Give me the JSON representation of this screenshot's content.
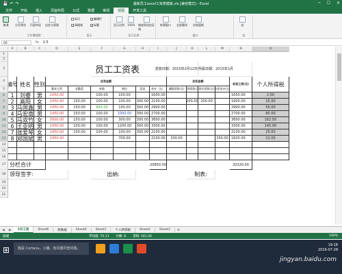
{
  "window": {
    "title": "最新员工excel工资表模板.xls [兼容模式] - Excel",
    "controls": [
      "─",
      "☐",
      "✕"
    ],
    "qat_icons": [
      "save-icon",
      "undo-icon",
      "redo-icon"
    ]
  },
  "ribbon": {
    "tabs": [
      "文件",
      "开始",
      "插入",
      "页面布局",
      "公式",
      "数据",
      "审阅",
      "视图",
      "开发工具"
    ],
    "active_tab": "视图",
    "groups": [
      {
        "label": "工作簿视图",
        "buttons": [
          "普通",
          "分页预览",
          "页面布局",
          "自定义视图"
        ]
      },
      {
        "label": "显示",
        "checks": [
          {
            "label": "标尺",
            "checked": false
          },
          {
            "label": "编辑栏",
            "checked": true
          },
          {
            "label": "网格线",
            "checked": true
          },
          {
            "label": "标题",
            "checked": true
          }
        ]
      },
      {
        "label": "显示比例",
        "buttons": [
          "显示比例",
          "100%",
          "缩放到选定区域"
        ]
      },
      {
        "label": "窗口",
        "buttons": [
          "新建窗口",
          "全部重排",
          "冻结窗格"
        ]
      },
      {
        "label": "宏",
        "buttons": [
          "宏"
        ]
      }
    ]
  },
  "formula_bar": {
    "name_box": "O6",
    "fx": "fx",
    "value": "2.5"
  },
  "grid": {
    "columns": [
      "A",
      "B",
      "C",
      "D",
      "E",
      "F",
      "G",
      "H",
      "I",
      "J",
      "K",
      "L",
      "M",
      "N",
      "O"
    ],
    "selected_column": "O",
    "rows": [
      "1",
      "2",
      "3",
      "4",
      "5",
      "6",
      "7",
      "8",
      "9",
      "10",
      "11",
      "12",
      "13",
      "14",
      "15",
      "16",
      "17",
      "18",
      "19",
      "20",
      "21"
    ],
    "selected_rows": [
      "6",
      "7",
      "8",
      "9",
      "10",
      "11",
      "12",
      "13"
    ]
  },
  "payroll": {
    "title": "员工工资表",
    "issue_date": "发放日期：2015年2月12日",
    "period": "所属日期：2015年1月",
    "header": {
      "number": "编号",
      "name": "姓名",
      "gender": "性别",
      "should_pay": "应发金额",
      "should_deduct": "应扣金额",
      "base": "基本工资",
      "full_attendance": "全勤奖",
      "subsidy": "补助",
      "post": "岗位",
      "bonus": "奖金",
      "total": "合计（元）",
      "leave_deduct": "请假扣款(元)",
      "late_deduct": "迟到扣款(元)",
      "other_deduct": "其它扣款(元)",
      "deduct_total": "应扣合计(元)",
      "actual": "实发工资(元)",
      "tax": "个人所得税"
    },
    "employees": [
      {
        "no": "1",
        "name": "刘睿",
        "gender": "男",
        "base": "1450.00",
        "full": "",
        "subsidy": "100.00",
        "post": "100.00",
        "bonus": "",
        "total": "1650.00",
        "leave": "",
        "late": "",
        "other": "",
        "deduct": "",
        "actual": "1650.00",
        "tax": "2.50"
      },
      {
        "no": "2",
        "name": "高阳",
        "gender": "女",
        "base": "1450.00",
        "full": "150.00",
        "subsidy": "100.00",
        "post": "100.00",
        "bonus": "300.00",
        "total": "2100.00",
        "leave": "",
        "late": "200.00",
        "other": "200.00",
        "deduct": "",
        "actual": "1900.00",
        "tax": "15.00"
      },
      {
        "no": "3",
        "name": "马国鑫",
        "gender": "男",
        "base": "1450.00",
        "full": "150.00",
        "subsidy": "900.00",
        "post": "100.00",
        "bonus": "300.00",
        "total": "2900.00",
        "leave": "",
        "late": "",
        "other": "",
        "deduct": "",
        "actual": "2900.00",
        "tax": "55.00"
      },
      {
        "no": "4",
        "name": "马宏南",
        "gender": "男",
        "base": "1450.00",
        "full": "150.00",
        "subsidy": "100.00",
        "post": "1000.00",
        "bonus": "300.00",
        "total": "2700.00",
        "leave": "",
        "late": "",
        "other": "",
        "deduct": "",
        "actual": "2700.00",
        "tax": "85.00"
      },
      {
        "no": "5",
        "name": "马双竹",
        "gender": "女",
        "base": "3000.00",
        "full": "150.00",
        "subsidy": "100.00",
        "post": "300.00",
        "bonus": "300.00",
        "total": "3850.00",
        "leave": "",
        "late": "",
        "other": "",
        "deduct": "",
        "actual": "3850.00",
        "tax": "162.50"
      },
      {
        "no": "6",
        "name": "王亚明",
        "gender": "男",
        "base": "1450.00",
        "full": "150.00",
        "subsidy": "100.00",
        "post": "1200.00",
        "bonus": "300.00",
        "total": "3300.00",
        "leave": "",
        "late": "",
        "other": "",
        "deduct": "",
        "actual": "3300.00",
        "tax": "145.00"
      },
      {
        "no": "7",
        "name": "张爱琴",
        "gender": "女",
        "base": "1450.00",
        "full": "150.00",
        "subsidy": "100.00",
        "post": "100.00",
        "bonus": "300.00",
        "total": "2100.00",
        "leave": "",
        "late": "",
        "other": "",
        "deduct": "",
        "actual": "2100.00",
        "tax": "25.00"
      },
      {
        "no": "8",
        "name": "郑国斌",
        "gender": "男",
        "base": "1450.00",
        "full": "",
        "subsidy": "",
        "post": "700.00",
        "bonus": "",
        "total": "2150.00",
        "leave": "330.00",
        "late": "",
        "other": "",
        "deduct": "330.00",
        "actual": "1820.00",
        "tax": "11.00"
      }
    ],
    "subtotal_label": "分栏合计",
    "subtotal_total": "20850.00",
    "subtotal_actual": "20320.00",
    "sign": {
      "leader": "领导签字:",
      "cashier": "出纳:",
      "preparer": "制表:"
    }
  },
  "sheet_tabs": {
    "tabs": [
      "5月工资",
      "Sheet6",
      "原数据",
      "Sheet4",
      "Sheet1",
      "个人所得税",
      "Sheet2",
      "Sheet3"
    ],
    "active": "5月工资"
  },
  "status_bar": {
    "ready": "就绪",
    "average": "平均值: 70.13",
    "count": "计数: 8",
    "sum": "求和: 561.00",
    "zoom": "100%"
  },
  "taskbar": {
    "search": "我是 Cortana，小娜。有问题尽管问我。",
    "time": "19:18",
    "date": "2016-07-28",
    "watermark": "jingyan.baidu.com",
    "app_colors": [
      "#f0a020",
      "#2f7bd8",
      "#1d8f4c",
      "#e04a2a"
    ]
  }
}
